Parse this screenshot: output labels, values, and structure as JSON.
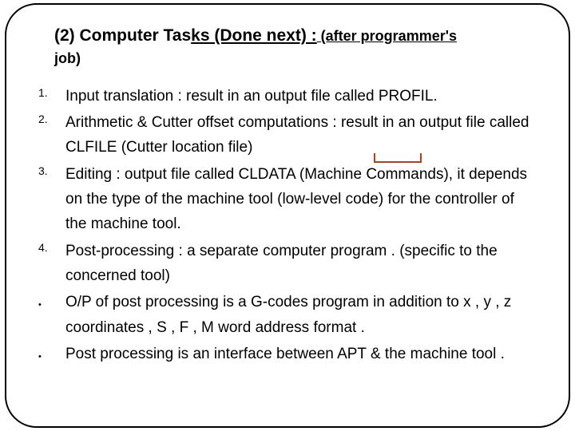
{
  "heading": {
    "prefix": "(2) Computer Tas",
    "underlined_part": "ks (Done next) :",
    "paren": " (after programmer's ",
    "job": "job)"
  },
  "items": [
    {
      "marker": "1.",
      "type": "num",
      "text": "Input translation : result in an output file called PROFIL."
    },
    {
      "marker": "2.",
      "type": "num",
      "text": "Arithmetic & Cutter offset computations : result in an output file called CLFILE (Cutter location file)"
    },
    {
      "marker": "3.",
      "type": "num",
      "text": "Editing : output file called CLDATA (Machine Commands), it depends on the type of the machine tool (low-level code) for the controller of the machine tool."
    },
    {
      "marker": "4.",
      "type": "num",
      "text": "Post-processing : a separate computer program . (specific to the concerned tool)"
    },
    {
      "marker": "•",
      "type": "bullet",
      "text": "O/P of post processing is a G-codes program in addition to x , y , z coordinates , S , F , M word address format ."
    },
    {
      "marker": "•",
      "type": "bullet",
      "text": "Post processing is an interface between APT & the machine tool ."
    }
  ]
}
